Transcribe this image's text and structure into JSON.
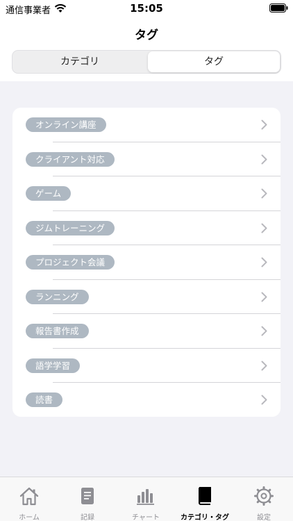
{
  "status": {
    "carrier": "通信事業者",
    "time": "15:05"
  },
  "nav": {
    "title": "タグ"
  },
  "segment": {
    "left": "カテゴリ",
    "right": "タグ",
    "selected": "タグ"
  },
  "tags": [
    {
      "label": "オンライン講座"
    },
    {
      "label": "クライアント対応"
    },
    {
      "label": "ゲーム"
    },
    {
      "label": "ジムトレーニング"
    },
    {
      "label": "プロジェクト会議"
    },
    {
      "label": "ランニング"
    },
    {
      "label": "報告書作成"
    },
    {
      "label": "語学学習"
    },
    {
      "label": "読書"
    }
  ],
  "tabbar": {
    "items": [
      {
        "label": "ホーム",
        "icon": "house-icon"
      },
      {
        "label": "記録",
        "icon": "document-icon"
      },
      {
        "label": "チャート",
        "icon": "bar-chart-icon"
      },
      {
        "label": "カテゴリ・タグ",
        "icon": "book-icon"
      },
      {
        "label": "設定",
        "icon": "gear-icon"
      }
    ],
    "active": "カテゴリ・タグ"
  },
  "colors": {
    "tag_bg": "#aeb8c2",
    "tab_inactive": "#8e8e93",
    "background": "#f2f2f7"
  }
}
